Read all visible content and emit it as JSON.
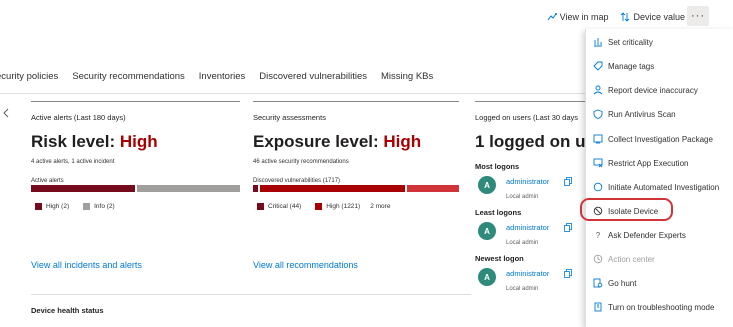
{
  "toolbar": {
    "view_in_map": "View in map",
    "device_value": "Device value",
    "more": "···"
  },
  "tabs": [
    "ecurity policies",
    "Security recommendations",
    "Inventories",
    "Discovered vulnerabilities",
    "Missing KBs"
  ],
  "alerts_card": {
    "title": "Active alerts (Last 180 days)",
    "risk_prefix": "Risk level: ",
    "risk_value": "High",
    "summary": "4 active alerts, 1 active incident",
    "bar_label": "Active alerts",
    "high_count": 2,
    "info_count": 2,
    "legend_high": "High (2)",
    "legend_info": "Info (2)",
    "link": "View all incidents and alerts"
  },
  "assessments_card": {
    "title": "Security assessments",
    "exposure_prefix": "Exposure level: ",
    "exposure_value": "High",
    "summary": "46 active security recommendations",
    "bar_label": "Discovered vulnerabilities (1717)",
    "critical_count": 44,
    "high_count": 1221,
    "legend_critical": "Critical (44)",
    "legend_high": "High (1221)",
    "legend_more": "2 more",
    "link": "View all recommendations"
  },
  "logon_card": {
    "title": "Logged on users (Last 30 days",
    "headline": "1 logged on us",
    "sections": [
      {
        "label": "Most logons",
        "user": "administrator",
        "role": "Local admin",
        "initial": "A"
      },
      {
        "label": "Least logons",
        "user": "administrator",
        "role": "Local admin",
        "initial": "A"
      },
      {
        "label": "Newest logon",
        "user": "administrator",
        "role": "Local admin",
        "initial": "A"
      }
    ]
  },
  "health": {
    "title": "Device health status"
  },
  "menu": {
    "items": [
      {
        "label": "Set criticality",
        "icon": "criticality-icon",
        "disabled": false
      },
      {
        "label": "Manage tags",
        "icon": "tag-icon",
        "disabled": false
      },
      {
        "label": "Report device inaccuracy",
        "icon": "report-icon",
        "disabled": false
      },
      {
        "label": "Run Antivirus Scan",
        "icon": "shield-icon",
        "disabled": false
      },
      {
        "label": "Collect Investigation Package",
        "icon": "package-icon",
        "disabled": false
      },
      {
        "label": "Restrict App Execution",
        "icon": "restrict-icon",
        "disabled": false
      },
      {
        "label": "Initiate Automated Investigation",
        "icon": "investigation-icon",
        "disabled": false
      },
      {
        "label": "Isolate Device",
        "icon": "isolate-icon",
        "disabled": false
      },
      {
        "label": "Ask Defender Experts",
        "icon": "question-icon",
        "disabled": false
      },
      {
        "label": "Action center",
        "icon": "action-center-icon",
        "disabled": true
      },
      {
        "label": "Go hunt",
        "icon": "hunt-icon",
        "disabled": false
      },
      {
        "label": "Turn on troubleshooting mode",
        "icon": "troubleshoot-icon",
        "disabled": false
      }
    ]
  },
  "colors": {
    "high": "#a80000",
    "critical": "#750b1c",
    "high_bar": "#d13438",
    "info": "#a19f9d",
    "link": "#0078d4",
    "avatar": "#2e8b7b",
    "highlight": "#d13438"
  }
}
